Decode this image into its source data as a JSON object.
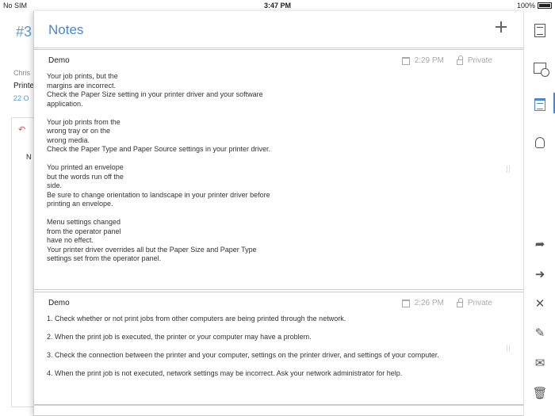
{
  "statusbar": {
    "carrier": "No SIM",
    "time": "3:47 PM",
    "battery": "100%"
  },
  "background": {
    "title_fragment": "#3",
    "from_fragment": "Chris",
    "subject_fragment": "Printe",
    "date_fragment": "22 O",
    "body_fragment": "N"
  },
  "notes": {
    "title": "Notes",
    "items": [
      {
        "author": "Demo",
        "time": "2:29 PM",
        "visibility": "Private",
        "body": "Your job prints, but the\nmargins are incorrect.\nCheck the Paper Size setting in your printer driver and your software\napplication.\n\nYour job prints from the\nwrong tray or on the\nwrong media.\nCheck the Paper Type and Paper Source settings in your printer driver.\n\nYou printed an envelope\nbut the words run off the\nside.\nBe sure to change orientation to landscape in your printer driver before\nprinting an envelope.\n\nMenu settings changed\nfrom the operator panel\nhave no effect.\nYour printer driver overrides all but the Paper Size and Paper Type\nsettings set from the operator panel."
      },
      {
        "author": "Demo",
        "time": "2:26 PM",
        "visibility": "Private",
        "body": "1. Check whether or not print jobs from other computers are being printed through the network.\n\n2. When the print job is executed, the printer or your computer may have a problem.\n\n3. Check the connection between the printer and your computer, settings on the printer driver, and settings of your computer.\n\n4. When the print job is not executed, network settings may be incorrect. Ask your network administrator for help."
      }
    ]
  },
  "rail": {
    "icons": [
      "document-icon",
      "history-icon",
      "notes-icon",
      "lightbulb-icon",
      "forward-icon",
      "assign-icon",
      "close-icon",
      "edit-icon",
      "mail-icon",
      "trash-icon"
    ],
    "active": "notes-icon",
    "accent": "#4a86c8"
  }
}
